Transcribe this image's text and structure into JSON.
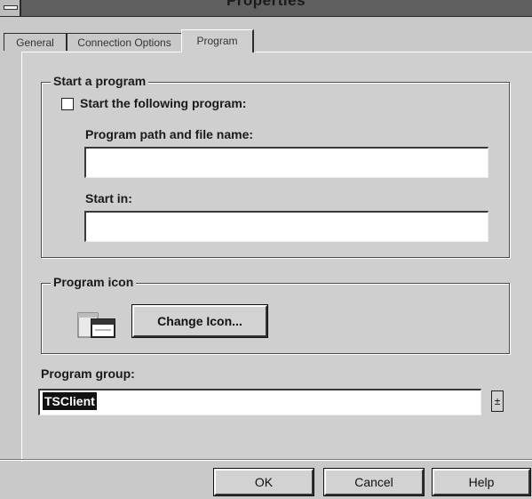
{
  "window": {
    "title": "Properties"
  },
  "tabs": [
    {
      "label": "General"
    },
    {
      "label": "Connection Options"
    },
    {
      "label": "Program"
    }
  ],
  "start_program": {
    "group_title": "Start a program",
    "checkbox_label": "Start the following program:",
    "checked": false,
    "path_label": "Program path and file name:",
    "path_value": "",
    "start_in_label": "Start in:",
    "start_in_value": ""
  },
  "program_icon": {
    "group_title": "Program icon",
    "icon": "program-window-icon",
    "change_button": "Change Icon..."
  },
  "program_group": {
    "label": "Program group:",
    "selected": "TSClient",
    "dropdown_icon": "dropdown-arrow-icon"
  },
  "footer": {
    "ok": "OK",
    "cancel": "Cancel",
    "help": "Help"
  }
}
